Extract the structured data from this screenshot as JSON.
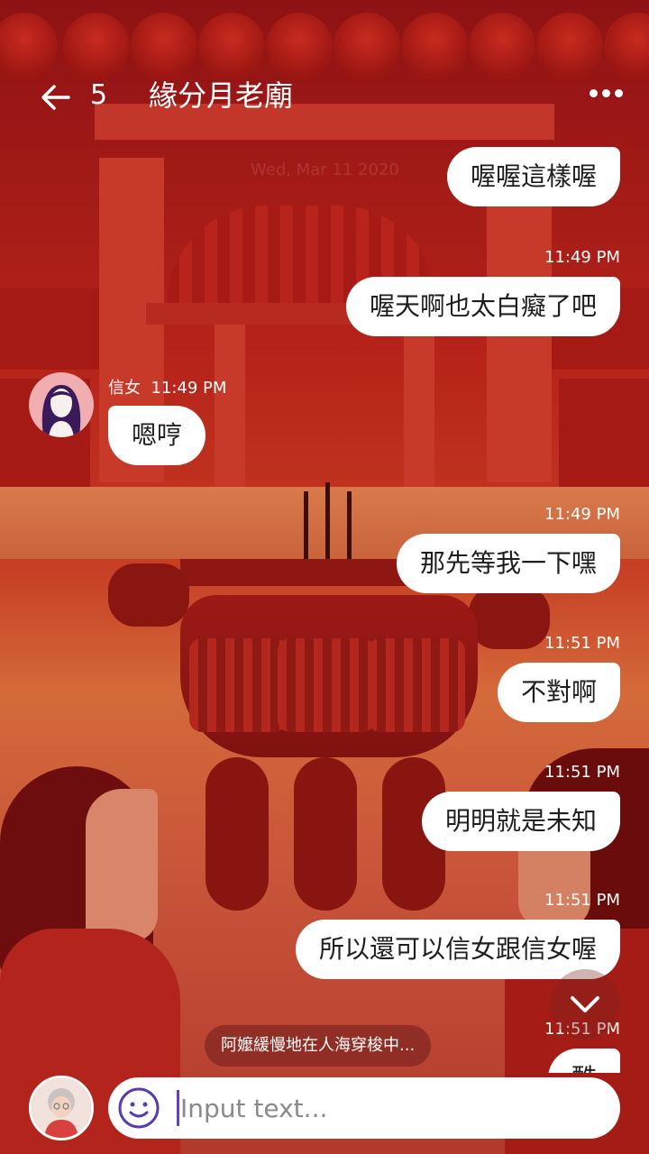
{
  "header": {
    "unread_count": "5",
    "title": "緣分月老廟"
  },
  "faded_date": "Wed, Mar 11 2020",
  "messages": [
    {
      "type": "out",
      "text": "喔喔這樣喔"
    },
    {
      "type": "out",
      "time": "11:49 PM",
      "text": "喔天啊也太白癡了吧"
    },
    {
      "type": "in",
      "sender": "信女",
      "time": "11:49 PM",
      "text": "嗯哼"
    },
    {
      "type": "out",
      "time": "11:49 PM",
      "text": "那先等我一下嘿"
    },
    {
      "type": "out",
      "time": "11:51 PM",
      "text": "不對啊"
    },
    {
      "type": "out",
      "time": "11:51 PM",
      "text": "明明就是未知"
    },
    {
      "type": "out",
      "time": "11:51 PM",
      "text": "所以還可以信女跟信女喔"
    },
    {
      "type": "out",
      "time": "11:51 PM",
      "text": "酷"
    }
  ],
  "status_text": "阿嬤緩慢地在人海穿梭中...",
  "input": {
    "placeholder": "Input text..."
  },
  "colors": {
    "background": "#b52219",
    "bubble": "#ffffff",
    "caret": "#6a3fb5",
    "emoji_icon": "#5a3bb0"
  },
  "icons": [
    "back-arrow-icon",
    "more-dots-icon",
    "chevron-down-icon",
    "smiley-icon"
  ]
}
